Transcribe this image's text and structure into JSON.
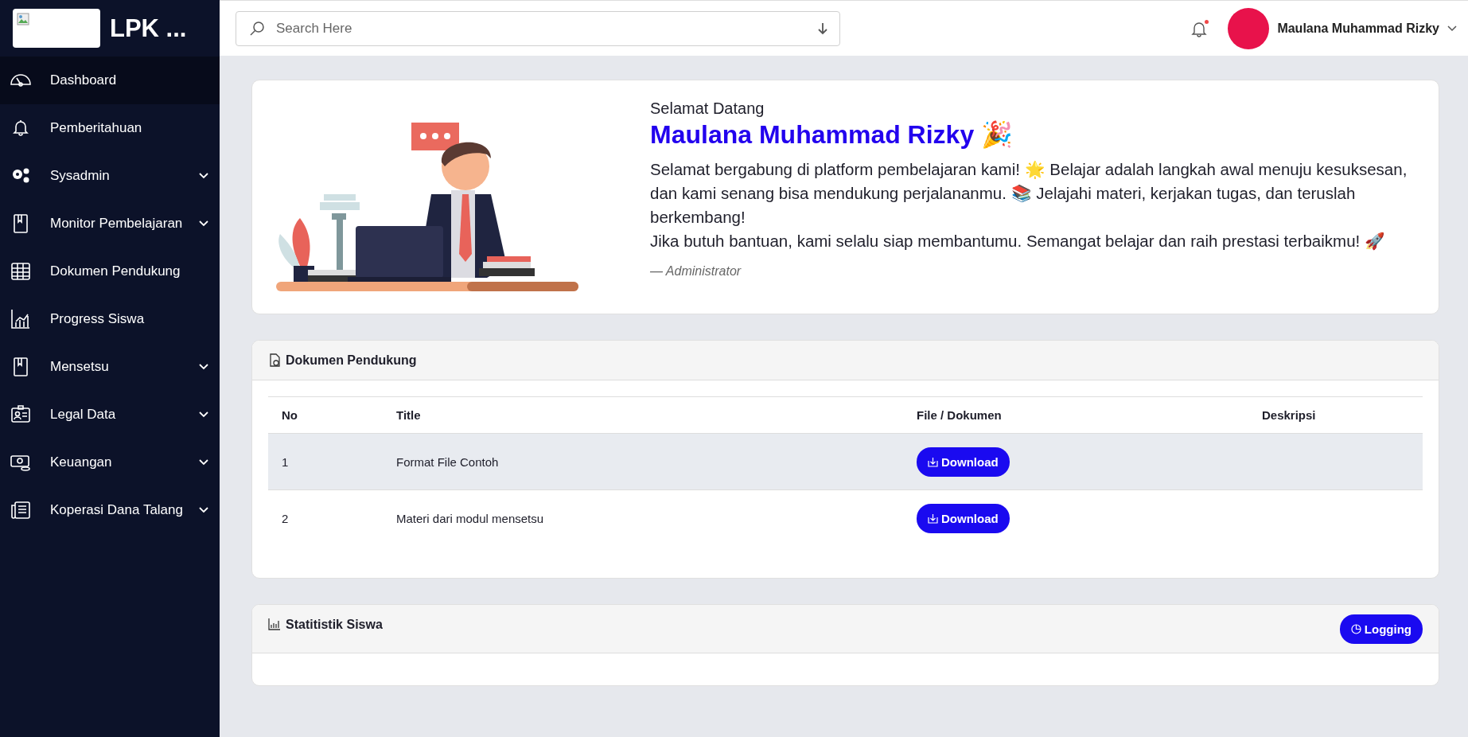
{
  "sidebar": {
    "brand": "LPK ...",
    "items": [
      {
        "label": "Dashboard",
        "selected": true,
        "has_submenu": false
      },
      {
        "label": "Pemberitahuan",
        "selected": false,
        "has_submenu": false
      },
      {
        "label": "Sysadmin",
        "selected": false,
        "has_submenu": true
      },
      {
        "label": "Monitor Pembelajaran",
        "selected": false,
        "has_submenu": true
      },
      {
        "label": "Dokumen Pendukung",
        "selected": false,
        "has_submenu": false
      },
      {
        "label": "Progress Siswa",
        "selected": false,
        "has_submenu": false
      },
      {
        "label": "Mensetsu",
        "selected": false,
        "has_submenu": true
      },
      {
        "label": "Legal Data",
        "selected": false,
        "has_submenu": true
      },
      {
        "label": "Keuangan",
        "selected": false,
        "has_submenu": true
      },
      {
        "label": "Koperasi Dana Talang",
        "selected": false,
        "has_submenu": true
      }
    ]
  },
  "header": {
    "search": {
      "placeholder": "Search Here"
    },
    "notification_unread": true,
    "user_name": "Maulana Muhammad Rizky"
  },
  "welcome": {
    "greeting": "Selamat Datang",
    "name": "Maulana Muhammad Rizky 🎉",
    "paragraphs": [
      "Selamat bergabung di platform pembelajaran kami! 🌟 Belajar adalah langkah awal menuju kesuksesan, dan kami senang bisa mendukung perjalananmu. 📚 Jelajahi materi, kerjakan tugas, dan teruslah berkembang!",
      "Jika butuh bantuan, kami selalu siap membantumu. Semangat belajar dan raih prestasi terbaikmu! 🚀"
    ],
    "signature": "— Administrator"
  },
  "documents": {
    "title": "Dokumen Pendukung",
    "table": {
      "columns": [
        "No",
        "Title",
        "File / Dokumen",
        "Deskripsi"
      ],
      "rows": [
        {
          "no": "1",
          "title": "Format File Contoh",
          "button": "Download",
          "highlighted": true
        },
        {
          "no": "2",
          "title": "Materi dari modul mensetsu",
          "button": "Download",
          "highlighted": false
        }
      ]
    }
  },
  "statistics": {
    "title": "Statitistik Siswa",
    "button": "Logging"
  }
}
